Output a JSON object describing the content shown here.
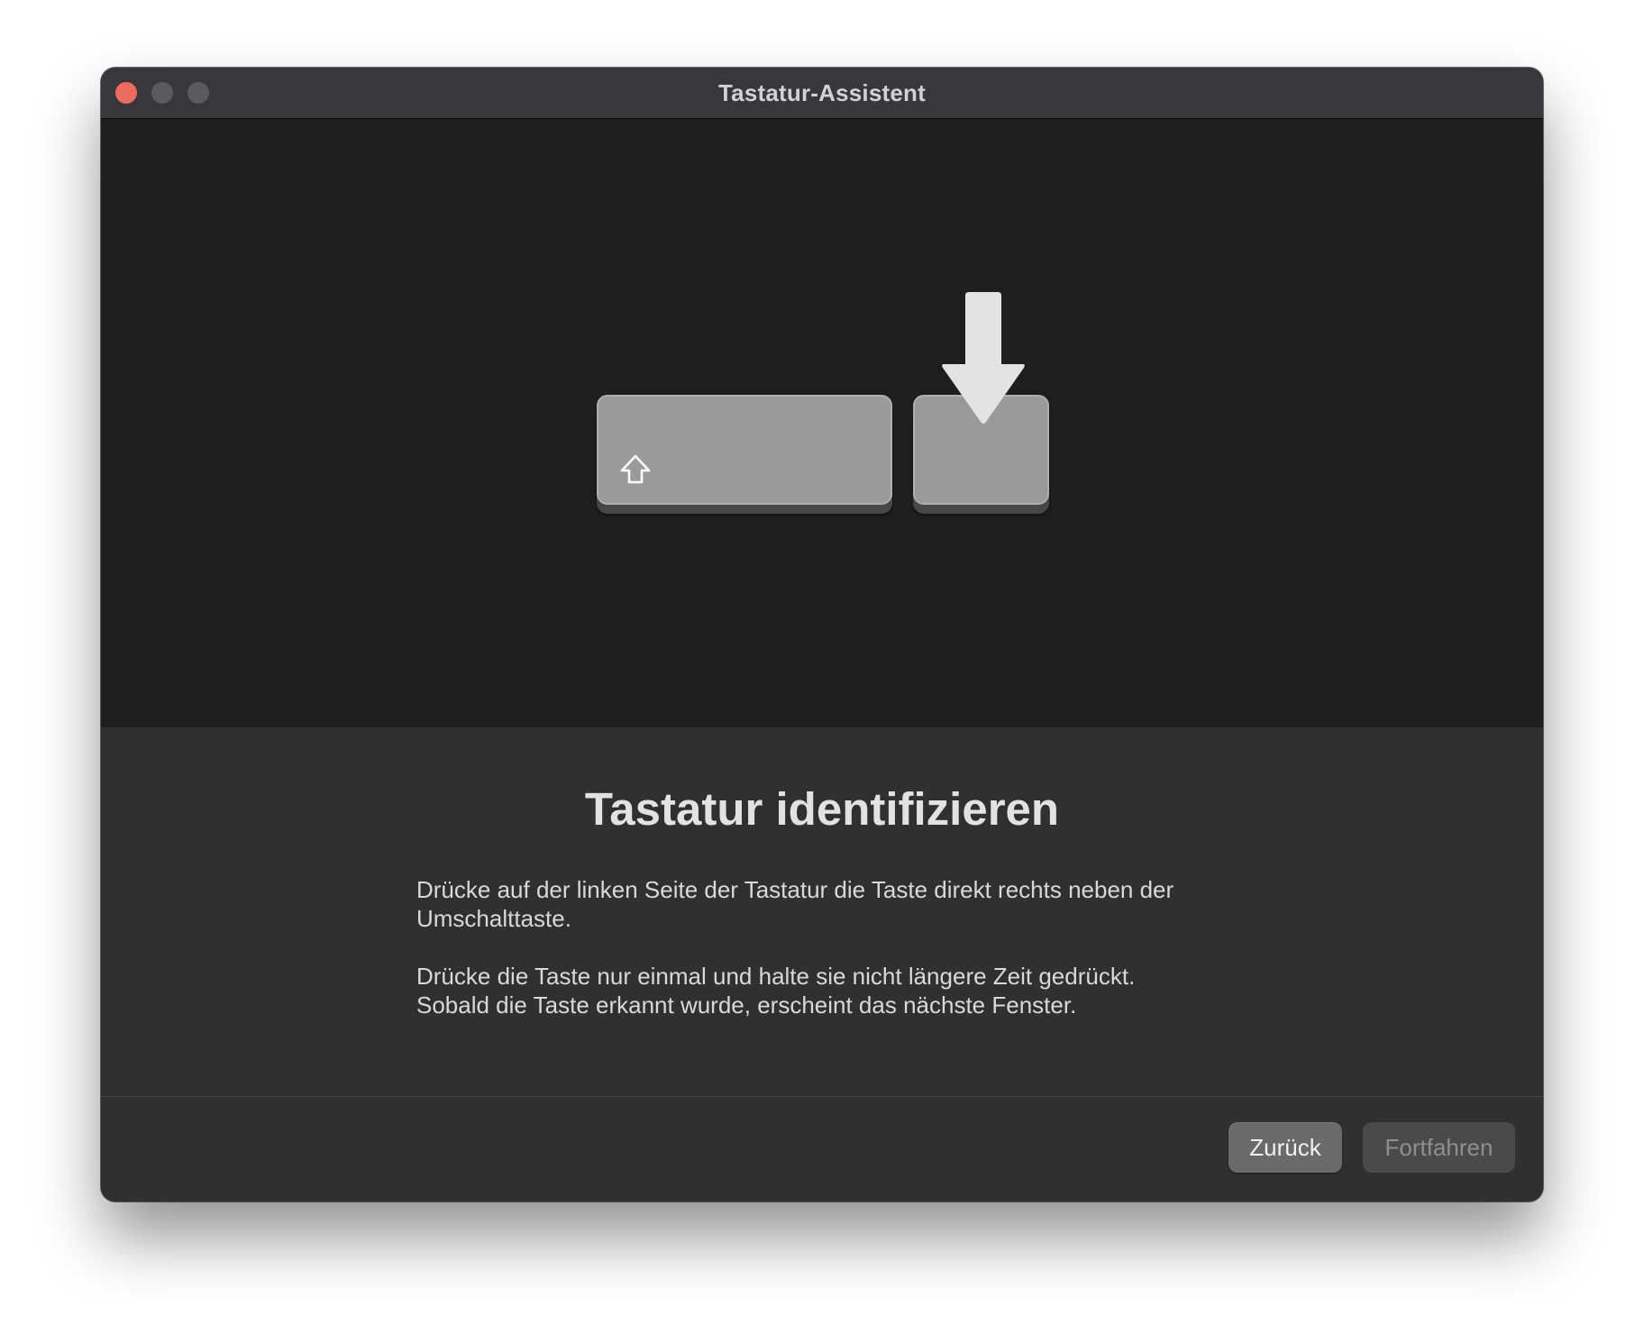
{
  "window": {
    "title": "Tastatur-Assistent",
    "traffic_lights": {
      "close_color": "#ec6a5e",
      "minimize_color": "#5b5a5f",
      "zoom_color": "#5b5a5f"
    }
  },
  "illustration": {
    "left_key_icon": "shift-icon",
    "target_indicator_icon": "arrow-down-icon"
  },
  "content": {
    "heading": "Tastatur identifizieren",
    "paragraph_1_line_1": "Drücke auf der linken Seite der Tastatur die Taste direkt rechts neben der",
    "paragraph_1_line_2": "Umschalttaste.",
    "paragraph_2_line_1": "Drücke die Taste nur einmal und halte sie nicht längere Zeit gedrückt.",
    "paragraph_2_line_2": "Sobald die Taste erkannt wurde, erscheint das nächste Fenster."
  },
  "footer": {
    "back_label": "Zurück",
    "continue_label": "Fortfahren",
    "continue_enabled": false
  }
}
